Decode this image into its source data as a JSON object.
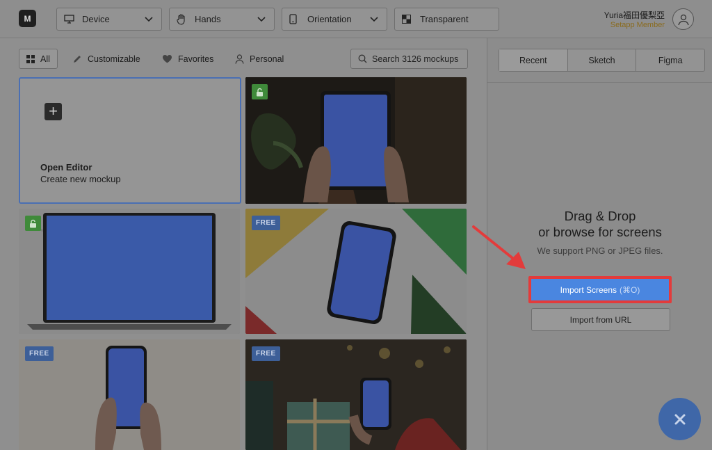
{
  "app": {
    "logo_letter": "M"
  },
  "toolbar": {
    "device_label": "Device",
    "hands_label": "Hands",
    "orientation_label": "Orientation",
    "background_label": "Transparent"
  },
  "user": {
    "name": "Yuria福田優梨亞",
    "role": "Setapp Member"
  },
  "filters": {
    "all": "All",
    "customizable": "Customizable",
    "favorites": "Favorites",
    "personal": "Personal",
    "search_placeholder": "Search 3126 mockups"
  },
  "open_editor": {
    "title": "Open Editor",
    "subtitle": "Create new mockup"
  },
  "cards": [
    {
      "badge": "",
      "locked": true
    },
    {
      "badge": "",
      "locked": true
    },
    {
      "badge": "FREE",
      "locked": false
    },
    {
      "badge": "FREE",
      "locked": false
    },
    {
      "badge": "FREE",
      "locked": false
    }
  ],
  "panel": {
    "tabs": [
      "Recent",
      "Sketch",
      "Figma"
    ],
    "drop_line1": "Drag & Drop",
    "drop_line2": "or browse for screens",
    "support_text": "We support PNG or JPEG files.",
    "import_label": "Import Screens",
    "import_shortcut": "(⌘O)",
    "url_label": "Import from URL"
  },
  "colors": {
    "accent": "#4a86e0",
    "highlight": "#e33b3b",
    "member": "#8a6b1e",
    "lock": "#3f8a3a"
  }
}
